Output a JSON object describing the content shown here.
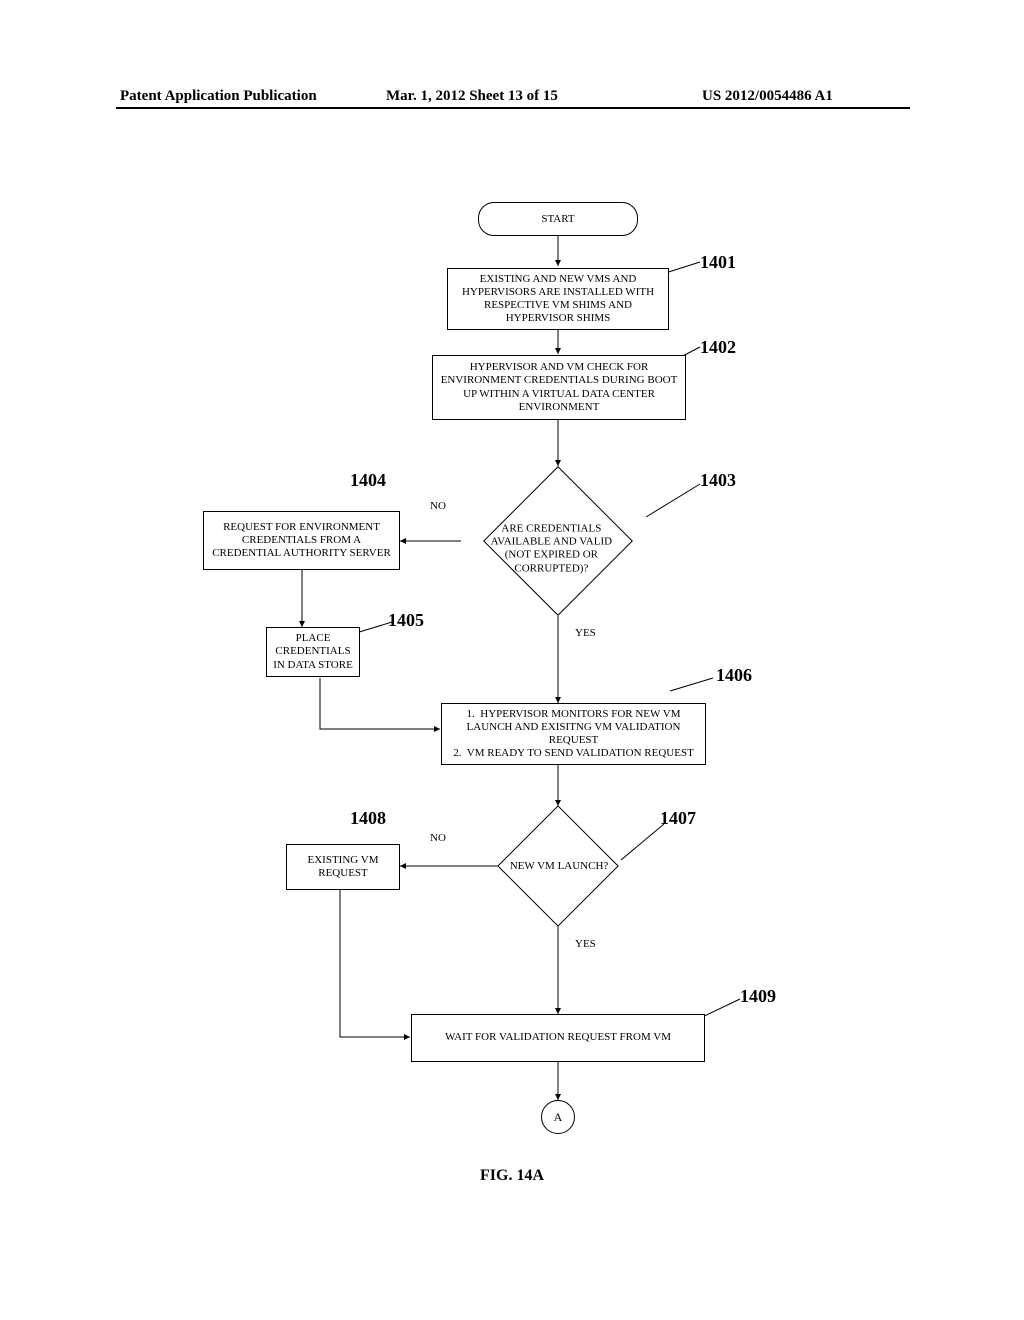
{
  "header": {
    "left": "Patent Application Publication",
    "center": "Mar. 1, 2012  Sheet 13 of 15",
    "right": "US 2012/0054486 A1"
  },
  "labels": {
    "l1401": "1401",
    "l1402": "1402",
    "l1403": "1403",
    "l1404": "1404",
    "l1405": "1405",
    "l1406": "1406",
    "l1407": "1407",
    "l1408": "1408",
    "l1409": "1409"
  },
  "nodes": {
    "start": "START",
    "n1401": "EXISTING AND NEW VMS AND HYPERVISORS ARE INSTALLED WITH RESPECTIVE VM SHIMS AND HYPERVISOR SHIMS",
    "n1402": "HYPERVISOR AND VM CHECK FOR ENVIRONMENT CREDENTIALS DURING BOOT UP WITHIN A VIRTUAL DATA CENTER ENVIRONMENT",
    "n1403": "ARE CREDENTIALS AVAILABLE AND VALID (NOT EXPIRED OR CORRUPTED)?",
    "n1404": "REQUEST FOR ENVIRONMENT CREDENTIALS FROM A CREDENTIAL AUTHORITY SERVER",
    "n1405": "PLACE CREDENTIALS IN DATA STORE",
    "n1406": "1.  HYPERVISOR MONITORS FOR NEW VM LAUNCH AND EXISITNG VM VALIDATION REQUEST\n2.  VM READY TO SEND VALIDATION REQUEST",
    "n1407": "NEW VM LAUNCH?",
    "n1408": "EXISTING VM REQUEST",
    "n1409": "WAIT FOR VALIDATION REQUEST FROM VM",
    "connA": "A"
  },
  "edges": {
    "no": "NO",
    "yes": "YES"
  },
  "figure": "FIG. 14A"
}
